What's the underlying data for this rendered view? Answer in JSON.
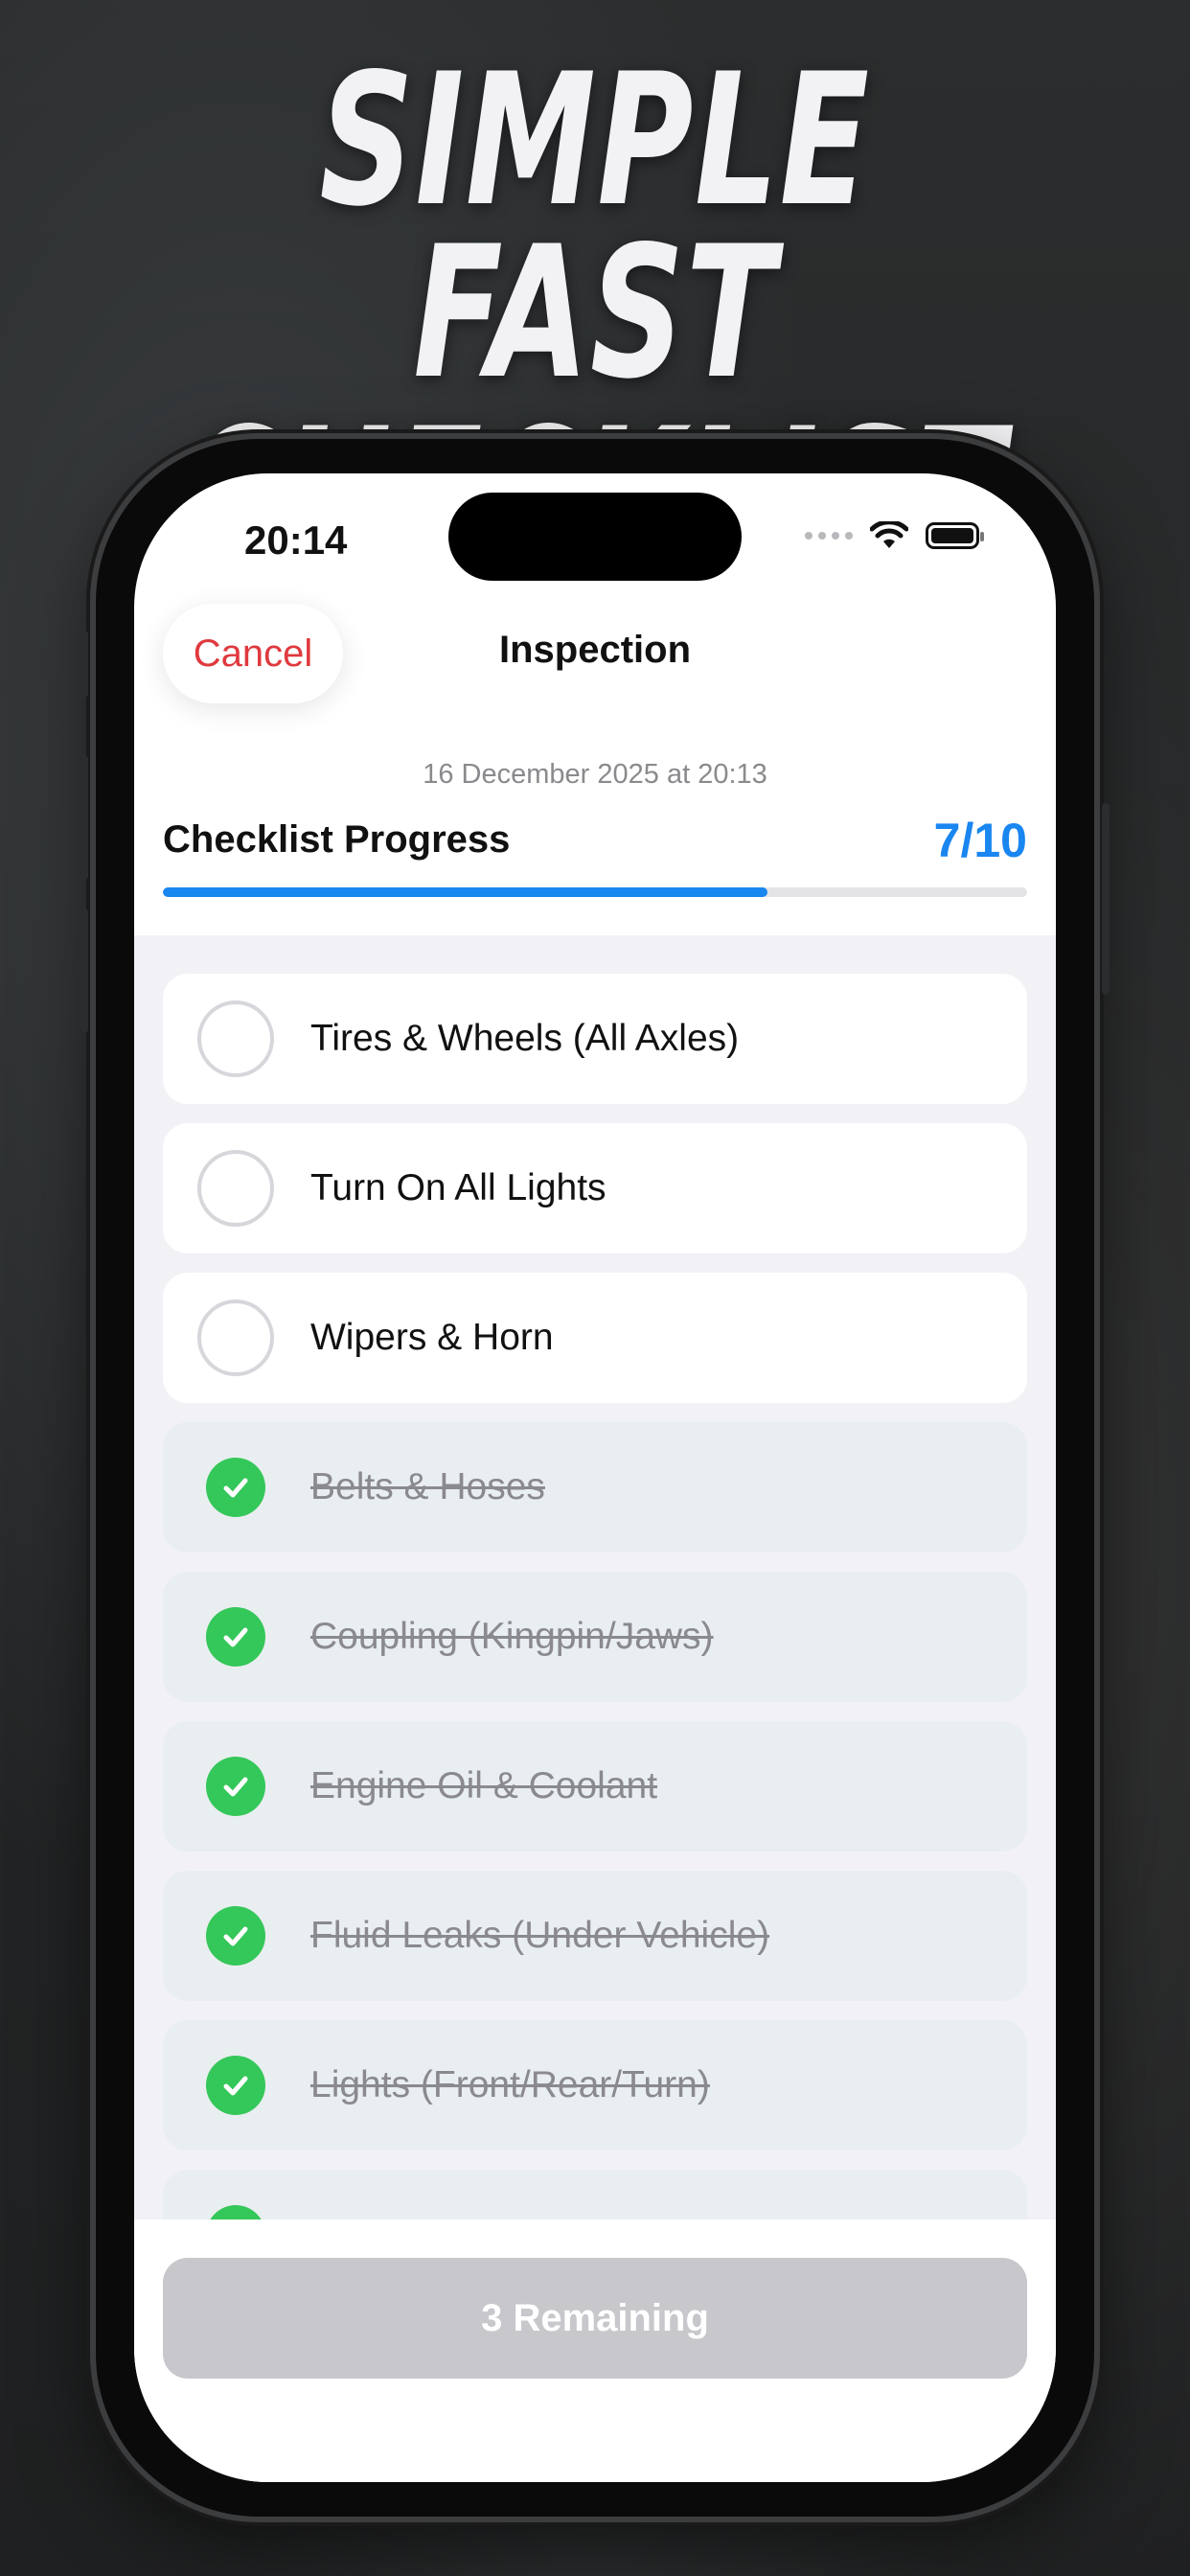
{
  "headline": {
    "line1": "SIMPLE",
    "line2": "FAST CHECKLIST"
  },
  "status_bar": {
    "time": "20:14"
  },
  "nav": {
    "cancel_label": "Cancel",
    "title": "Inspection"
  },
  "header": {
    "date": "16 December 2025 at 20:13",
    "progress_label": "Checklist Progress",
    "progress_count": "7/10",
    "progress_fraction": 0.7
  },
  "checklist": {
    "items": [
      {
        "label": "Tires & Wheels (All Axles)",
        "done": false
      },
      {
        "label": "Turn On All Lights",
        "done": false
      },
      {
        "label": "Wipers & Horn",
        "done": false
      },
      {
        "label": "Belts & Hoses",
        "done": true
      },
      {
        "label": "Coupling (Kingpin/Jaws)",
        "done": true
      },
      {
        "label": "Engine Oil & Coolant",
        "done": true
      },
      {
        "label": "Fluid Leaks (Under Vehicle)",
        "done": true
      },
      {
        "label": "Lights (Front/Rear/Turn)",
        "done": true
      },
      {
        "label": "",
        "done": true
      }
    ]
  },
  "footer": {
    "remaining_label": "3 Remaining"
  },
  "colors": {
    "accent": "#1a86f0",
    "cancel": "#e0393e",
    "check": "#34c759"
  }
}
